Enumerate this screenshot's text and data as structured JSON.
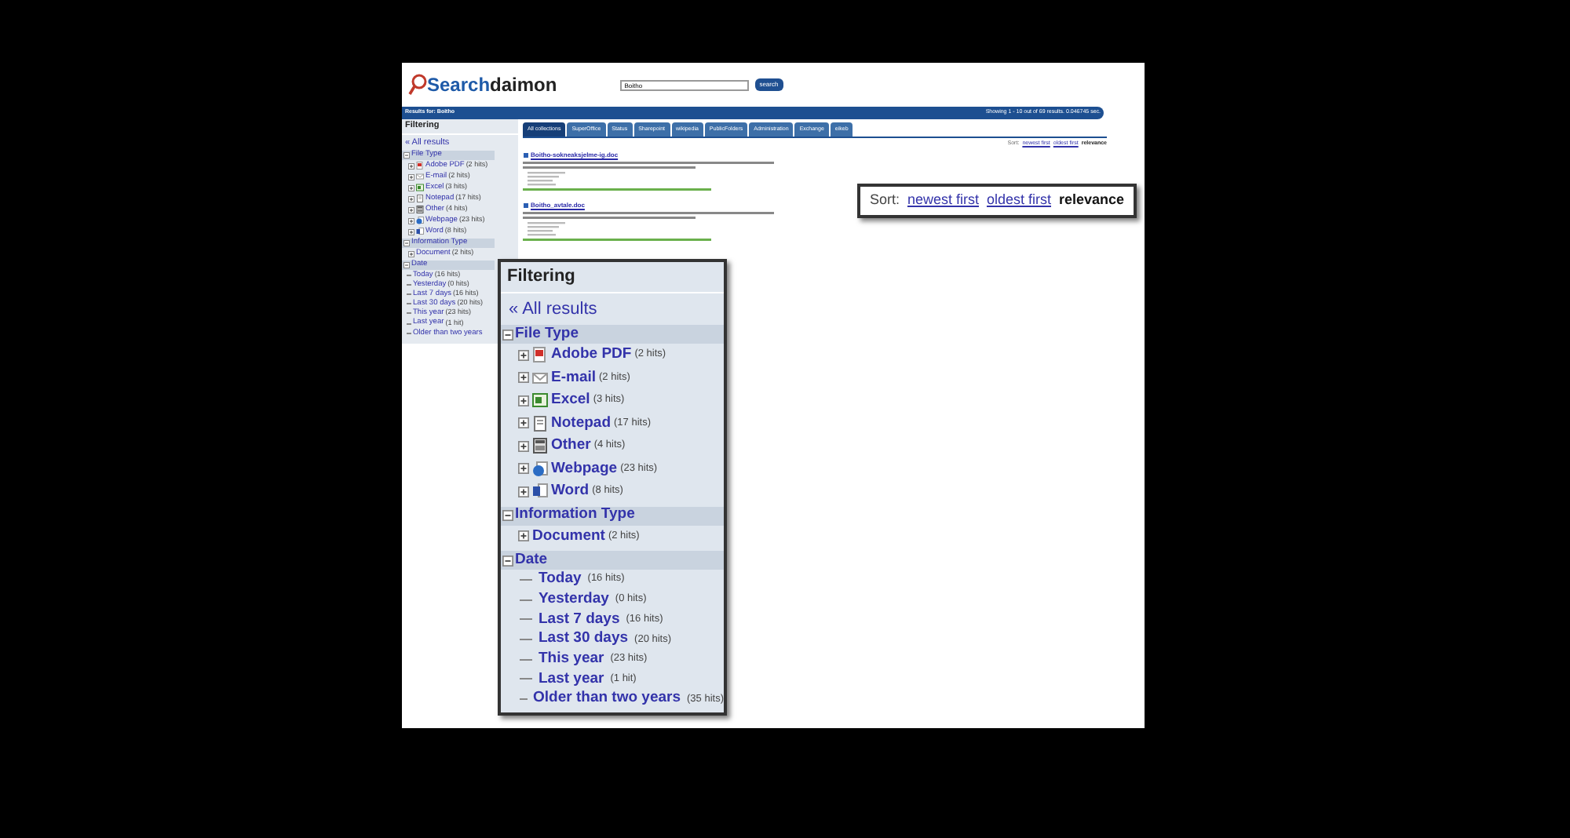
{
  "header": {
    "logo_first": "Search",
    "logo_second": "daimon",
    "search_value": "Boitho",
    "search_button": "search"
  },
  "results_bar": {
    "query": "Results for: Boitho",
    "summary": "Showing 1 - 10 out of 69 results. 0.046745 sec."
  },
  "tabs": [
    {
      "label": "All collections",
      "selected": true
    },
    {
      "label": "SuperOffice",
      "selected": false
    },
    {
      "label": "Status",
      "selected": false
    },
    {
      "label": "Sharepoint",
      "selected": false
    },
    {
      "label": "wikipedia",
      "selected": false
    },
    {
      "label": "PublicFolders",
      "selected": false
    },
    {
      "label": "Administration",
      "selected": false
    },
    {
      "label": "Exchange",
      "selected": false
    },
    {
      "label": "eikeb",
      "selected": false
    }
  ],
  "sort": {
    "label": "Sort:",
    "options": [
      {
        "label": "newest first",
        "selected": false
      },
      {
        "label": "oldest first",
        "selected": false
      },
      {
        "label": "relevance",
        "selected": true
      }
    ]
  },
  "results": [
    {
      "title": "Boitho-sokneaksjelme-ig.doc"
    },
    {
      "title": "Boitho_avtale.doc"
    }
  ],
  "sidebar": {
    "title": "Filtering",
    "all_results": "« All results",
    "groups": [
      {
        "label": "File Type",
        "expanded": true,
        "items": [
          {
            "kind": "pdf",
            "label": "Adobe PDF",
            "hits": "(2 hits)"
          },
          {
            "kind": "email",
            "label": "E-mail",
            "hits": "(2 hits)"
          },
          {
            "kind": "excel",
            "label": "Excel",
            "hits": "(3 hits)"
          },
          {
            "kind": "notepad",
            "label": "Notepad",
            "hits": "(17 hits)"
          },
          {
            "kind": "other",
            "label": "Other",
            "hits": "(4 hits)"
          },
          {
            "kind": "webpage",
            "label": "Webpage",
            "hits": "(23 hits)"
          },
          {
            "kind": "word",
            "label": "Word",
            "hits": "(8 hits)"
          }
        ]
      },
      {
        "label": "Information Type",
        "expanded": true,
        "items": [
          {
            "kind": "folder",
            "label": "Document",
            "hits": "(2 hits)"
          }
        ]
      },
      {
        "label": "Date",
        "expanded": true,
        "items": [
          {
            "kind": "date",
            "label": "Today",
            "hits": "(16 hits)"
          },
          {
            "kind": "date",
            "label": "Yesterday",
            "hits": "(0 hits)"
          },
          {
            "kind": "date",
            "label": "Last 7 days",
            "hits": "(16 hits)"
          },
          {
            "kind": "date",
            "label": "Last 30 days",
            "hits": "(20 hits)"
          },
          {
            "kind": "date",
            "label": "This year",
            "hits": "(23 hits)"
          },
          {
            "kind": "date",
            "label": "Last year",
            "hits": "(1 hit)"
          },
          {
            "kind": "date",
            "label": "Older than two years"
          }
        ]
      }
    ]
  },
  "sort_zoom": {
    "label": "Sort:",
    "options": [
      {
        "label": "newest first",
        "selected": false
      },
      {
        "label": "oldest first",
        "selected": false
      },
      {
        "label": "relevance",
        "selected": true
      }
    ]
  },
  "filtering_zoom": {
    "title": "Filtering",
    "all_results": "« All results",
    "groups": [
      {
        "label": "File Type",
        "expanded": true,
        "items": [
          {
            "kind": "pdf",
            "label": "Adobe PDF",
            "hits": "(2 hits)"
          },
          {
            "kind": "email",
            "label": "E-mail",
            "hits": "(2 hits)"
          },
          {
            "kind": "excel",
            "label": "Excel",
            "hits": "(3 hits)"
          },
          {
            "kind": "notepad",
            "label": "Notepad",
            "hits": "(17 hits)"
          },
          {
            "kind": "other",
            "label": "Other",
            "hits": "(4 hits)"
          },
          {
            "kind": "webpage",
            "label": "Webpage",
            "hits": "(23 hits)"
          },
          {
            "kind": "word",
            "label": "Word",
            "hits": "(8 hits)"
          }
        ]
      },
      {
        "label": "Information Type",
        "expanded": true,
        "items": [
          {
            "kind": "folder",
            "label": "Document",
            "hits": "(2 hits)"
          }
        ]
      },
      {
        "label": "Date",
        "expanded": true,
        "items": [
          {
            "kind": "date",
            "label": "Today",
            "hits": "(16 hits)"
          },
          {
            "kind": "date",
            "label": "Yesterday",
            "hits": "(0 hits)"
          },
          {
            "kind": "date",
            "label": "Last 7 days",
            "hits": "(16 hits)"
          },
          {
            "kind": "date",
            "label": "Last 30 days",
            "hits": "(20 hits)"
          },
          {
            "kind": "date",
            "label": "This year",
            "hits": "(23 hits)"
          },
          {
            "kind": "date",
            "label": "Last year",
            "hits": "(1 hit)"
          },
          {
            "kind": "date",
            "label": "Older than two years",
            "hits": "(35 hits)"
          }
        ]
      }
    ]
  }
}
